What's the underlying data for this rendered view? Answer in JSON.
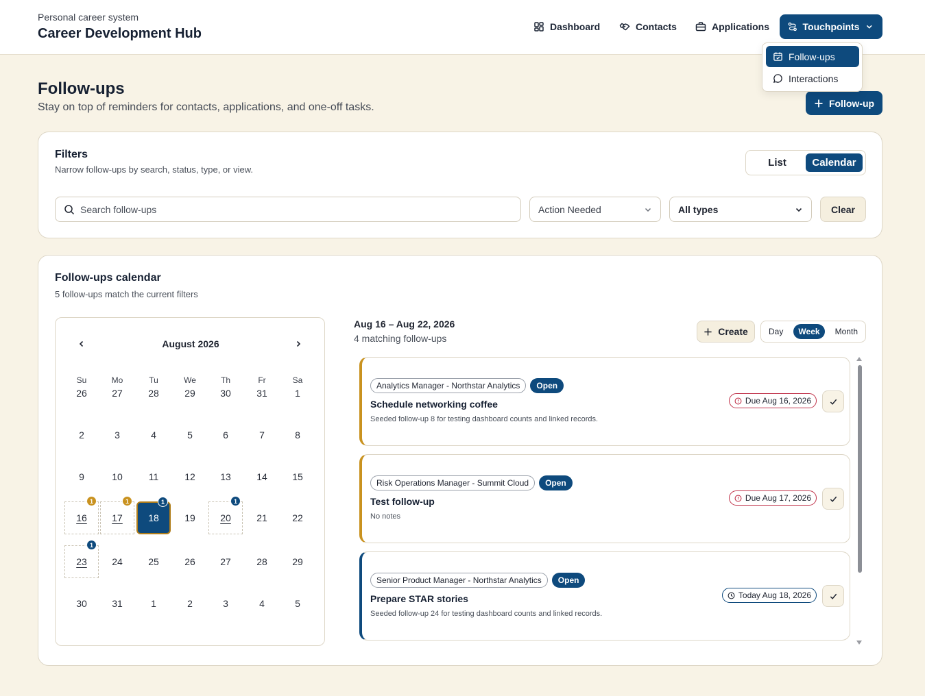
{
  "header": {
    "subtitle": "Personal career system",
    "title": "Career Development Hub",
    "nav": {
      "dashboard": "Dashboard",
      "contacts": "Contacts",
      "applications": "Applications",
      "touchpoints": "Touchpoints"
    },
    "touchpoints_menu": {
      "followups": "Follow-ups",
      "interactions": "Interactions"
    }
  },
  "page": {
    "title": "Follow-ups",
    "subtitle": "Stay on top of reminders for contacts, applications, and one-off tasks.",
    "new_button": "Follow-up"
  },
  "filters": {
    "title": "Filters",
    "subtitle": "Narrow follow-ups by search, status, type, or view.",
    "view_list": "List",
    "view_calendar": "Calendar",
    "search_placeholder": "Search follow-ups",
    "status_value": "Action Needed",
    "type_value": "All types",
    "clear_label": "Clear"
  },
  "calendar": {
    "title": "Follow-ups calendar",
    "subtitle": "5 follow-ups match the current filters",
    "month_label": "August 2026",
    "weekdays": [
      "Su",
      "Mo",
      "Tu",
      "We",
      "Th",
      "Fr",
      "Sa"
    ],
    "weeks": [
      [
        "26",
        "27",
        "28",
        "29",
        "30",
        "31",
        "1"
      ],
      [
        "2",
        "3",
        "4",
        "5",
        "6",
        "7",
        "8"
      ],
      [
        "9",
        "10",
        "11",
        "12",
        "13",
        "14",
        "15"
      ],
      [
        "16",
        "17",
        "18",
        "19",
        "20",
        "21",
        "22"
      ],
      [
        "23",
        "24",
        "25",
        "26",
        "27",
        "28",
        "29"
      ],
      [
        "30",
        "31",
        "1",
        "2",
        "3",
        "4",
        "5"
      ]
    ],
    "selected_day": "18",
    "day_counts": [
      {
        "day": "16",
        "count": "1",
        "tone": "amber"
      },
      {
        "day": "17",
        "count": "1",
        "tone": "amber"
      },
      {
        "day": "18",
        "count": "1",
        "tone": "blue"
      },
      {
        "day": "20",
        "count": "1",
        "tone": "blue"
      },
      {
        "day": "23",
        "count": "1",
        "tone": "blue"
      }
    ]
  },
  "agenda": {
    "range_label": "Aug 16 – Aug 22, 2026",
    "range_sub": "4 matching follow-ups",
    "create_label": "Create",
    "range_day": "Day",
    "range_week": "Week",
    "range_month": "Month",
    "items": [
      {
        "context": "Analytics Manager - Northstar Analytics",
        "status": "Open",
        "title": "Schedule networking coffee",
        "note": "Seeded follow-up 8 for testing dashboard counts and linked records.",
        "due": "Due Aug 16, 2026",
        "due_kind": "overdue",
        "accent": "#c9921f"
      },
      {
        "context": "Risk Operations Manager - Summit Cloud",
        "status": "Open",
        "title": "Test follow-up",
        "note": "No notes",
        "due": "Due Aug 17, 2026",
        "due_kind": "overdue",
        "accent": "#c9921f"
      },
      {
        "context": "Senior Product Manager - Northstar Analytics",
        "status": "Open",
        "title": "Prepare STAR stories",
        "note": "Seeded follow-up 24 for testing dashboard counts and linked records.",
        "due": "Today Aug 18, 2026",
        "due_kind": "today",
        "accent": "#0e4a7d"
      }
    ]
  },
  "colors": {
    "brand": "#0e4a7d",
    "accent_amber": "#c9921f",
    "overdue": "#c0334a",
    "page_bg": "#f8f3e6"
  }
}
